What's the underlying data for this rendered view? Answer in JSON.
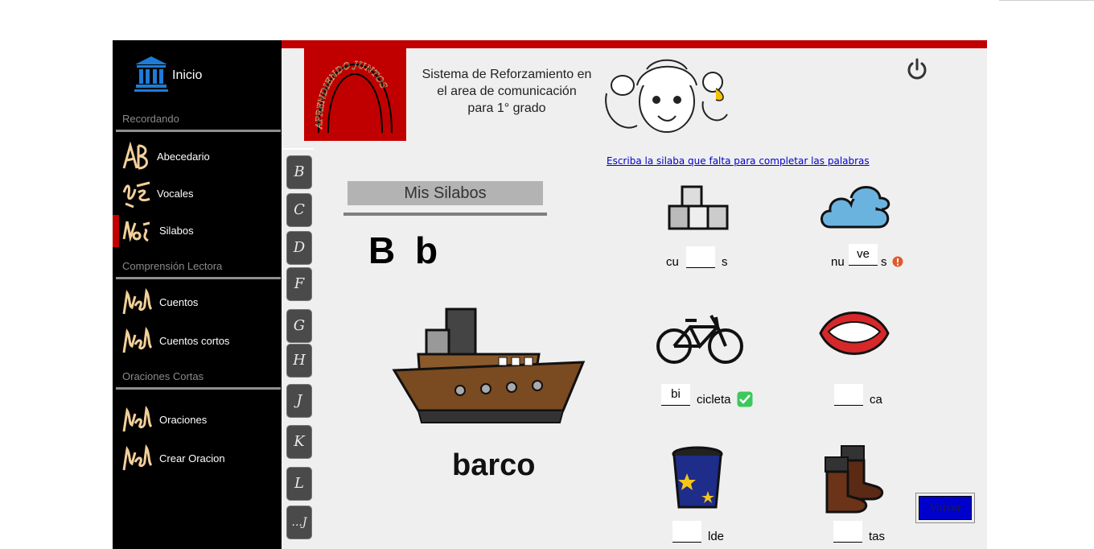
{
  "sidebar": {
    "home_label": "Inicio",
    "sections": {
      "recordando": "Recordando",
      "comprension": "Comprensión Lectora",
      "oraciones": "Oraciones Cortas"
    },
    "items": {
      "abecedario": "Abecedario",
      "vocales": "Vocales",
      "silabos": "Silabos",
      "cuentos": "Cuentos",
      "cuentos_cortos": "Cuentos cortos",
      "oraciones": "Oraciones",
      "crear_oracion": "Crear Oracion"
    }
  },
  "header": {
    "logo_text": "APRENDIENDO JUNTOS",
    "title_line1": "Sistema de Reforzamiento en",
    "title_line2": "el area de comunicación",
    "title_line3": "para 1° grado"
  },
  "letters": [
    "B",
    "C",
    "D",
    "F",
    "G",
    "H",
    "J",
    "K",
    "L",
    "...J"
  ],
  "lesson": {
    "title": "Mis Silabos",
    "letter": "B b",
    "word": "barco"
  },
  "exercise": {
    "instruction": "Escriba la silaba que falta para completar las palabras",
    "cubos": {
      "pre": "cu",
      "value": "",
      "post": "s"
    },
    "nubes": {
      "pre": "nu",
      "value": "ve",
      "post": "s"
    },
    "bicicleta": {
      "value": "bi",
      "post": "cicleta"
    },
    "boca": {
      "value": "",
      "post": "ca"
    },
    "balde": {
      "value": "",
      "post": "lde"
    },
    "botas": {
      "value": "",
      "post": "tas"
    }
  },
  "buttons": {
    "volver": "Volver"
  },
  "colors": {
    "accent_red": "#c00000",
    "sidebar_bg": "#000000",
    "content_bg": "#efefef",
    "link_blue": "#0000cc"
  }
}
